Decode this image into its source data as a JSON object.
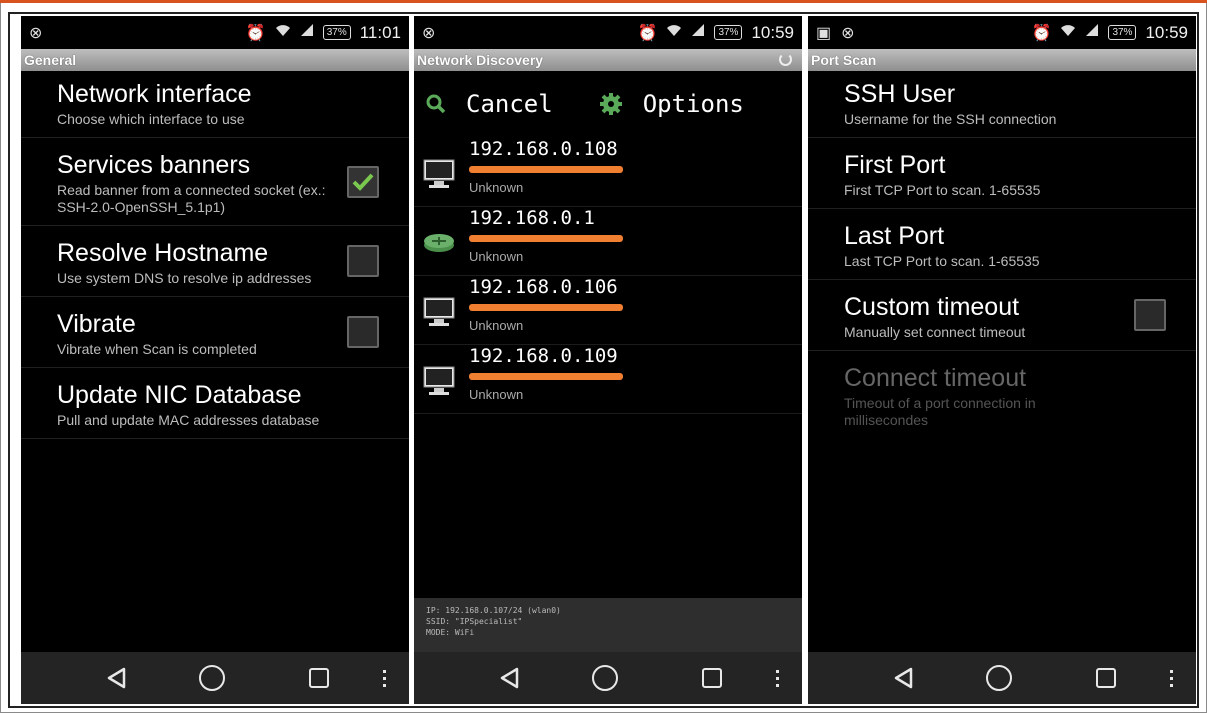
{
  "colors": {
    "accent_orange": "#f07f31",
    "frame_top": "#d9531e",
    "check_green": "#7ac74f",
    "action_green": "#5aaa5a",
    "router_green": "#6ab06a"
  },
  "screens": [
    {
      "status": {
        "time": "11:01",
        "battery": "37%"
      },
      "title": "General",
      "prefs": [
        {
          "title": "Network interface",
          "summary": "Choose which interface to use"
        },
        {
          "title": "Services banners",
          "summary": "Read banner from a connected socket (ex.: SSH-2.0-OpenSSH_5.1p1)",
          "checked": true
        },
        {
          "title": "Resolve Hostname",
          "summary": "Use system DNS to resolve ip addresses",
          "checked": false
        },
        {
          "title": "Vibrate",
          "summary": "Vibrate when Scan is completed",
          "checked": false
        },
        {
          "title": "Update NIC Database",
          "summary": "Pull and update MAC addresses database"
        }
      ]
    },
    {
      "status": {
        "time": "10:59",
        "battery": "37%"
      },
      "title": "Network Discovery",
      "actions": {
        "cancel": "Cancel",
        "options": "Options"
      },
      "hosts": [
        {
          "ip": "192.168.0.108",
          "vendor": "Unknown",
          "icon": "computer-icon"
        },
        {
          "ip": "192.168.0.1",
          "vendor": "Unknown",
          "icon": "router-icon"
        },
        {
          "ip": "192.168.0.106",
          "vendor": "Unknown",
          "icon": "computer-icon"
        },
        {
          "ip": "192.168.0.109",
          "vendor": "Unknown",
          "icon": "computer-icon"
        }
      ],
      "info": {
        "ip": "IP: 192.168.0.107/24 (wlan0)",
        "ssid": "SSID: \"IPSpecialist\"",
        "mode": "MODE: WiFi"
      }
    },
    {
      "status": {
        "time": "10:59",
        "battery": "37%"
      },
      "title": "Port Scan",
      "prefs": [
        {
          "title": "SSH User",
          "summary": "Username for the SSH connection"
        },
        {
          "title": "First Port",
          "summary": "First TCP Port to scan. 1-65535"
        },
        {
          "title": "Last Port",
          "summary": "Last TCP Port to scan. 1-65535"
        },
        {
          "title": "Custom timeout",
          "summary": "Manually set connect timeout",
          "checked": false
        },
        {
          "title": "Connect timeout",
          "summary": "Timeout of a port connection in millisecondes",
          "disabled": true
        }
      ]
    }
  ]
}
